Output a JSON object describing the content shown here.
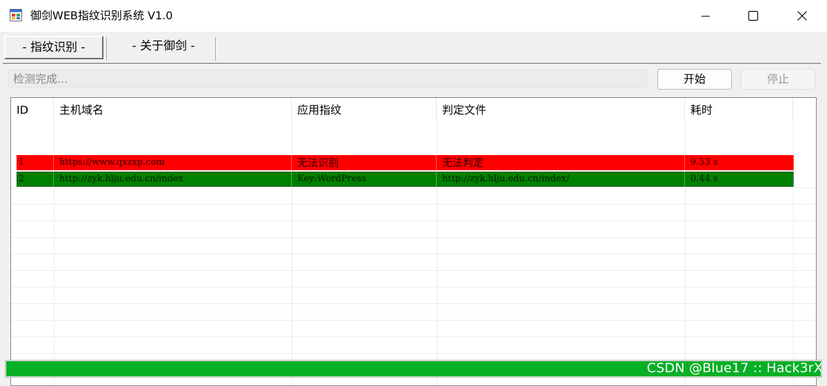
{
  "window": {
    "title": "御剑WEB指纹识别系统 V1.0",
    "icon": "app-window-icon",
    "controls": [
      "minimize-icon",
      "maximize-icon",
      "close-icon"
    ]
  },
  "tabs": [
    {
      "label": "- 指纹识别 -",
      "active": true
    },
    {
      "label": "- 关于御剑 -",
      "active": false
    }
  ],
  "status": {
    "value": "检测完成..."
  },
  "buttons": {
    "start": "开始",
    "stop": "停止",
    "stop_enabled": false
  },
  "table": {
    "columns": [
      "ID",
      "主机域名",
      "应用指纹",
      "判定文件",
      "耗时"
    ],
    "rows": [
      {
        "id": "1",
        "host": "https://www.qxzxp.com",
        "fingerprint": "无法识别",
        "file": "无法判定",
        "time": "9.53 s",
        "color": "#ff0000"
      },
      {
        "id": "2",
        "host": "http://zyk.hlju.edu.cn/index",
        "fingerprint": "Key:WordPress",
        "file": "http://zyk.hlju.edu.cn/index/",
        "time": "0.44 s",
        "color": "#008000"
      }
    ]
  },
  "progress": {
    "fraction": 1.0,
    "color": "#06b025"
  },
  "watermark": "CSDN @Blue17 :: Hack3rX"
}
